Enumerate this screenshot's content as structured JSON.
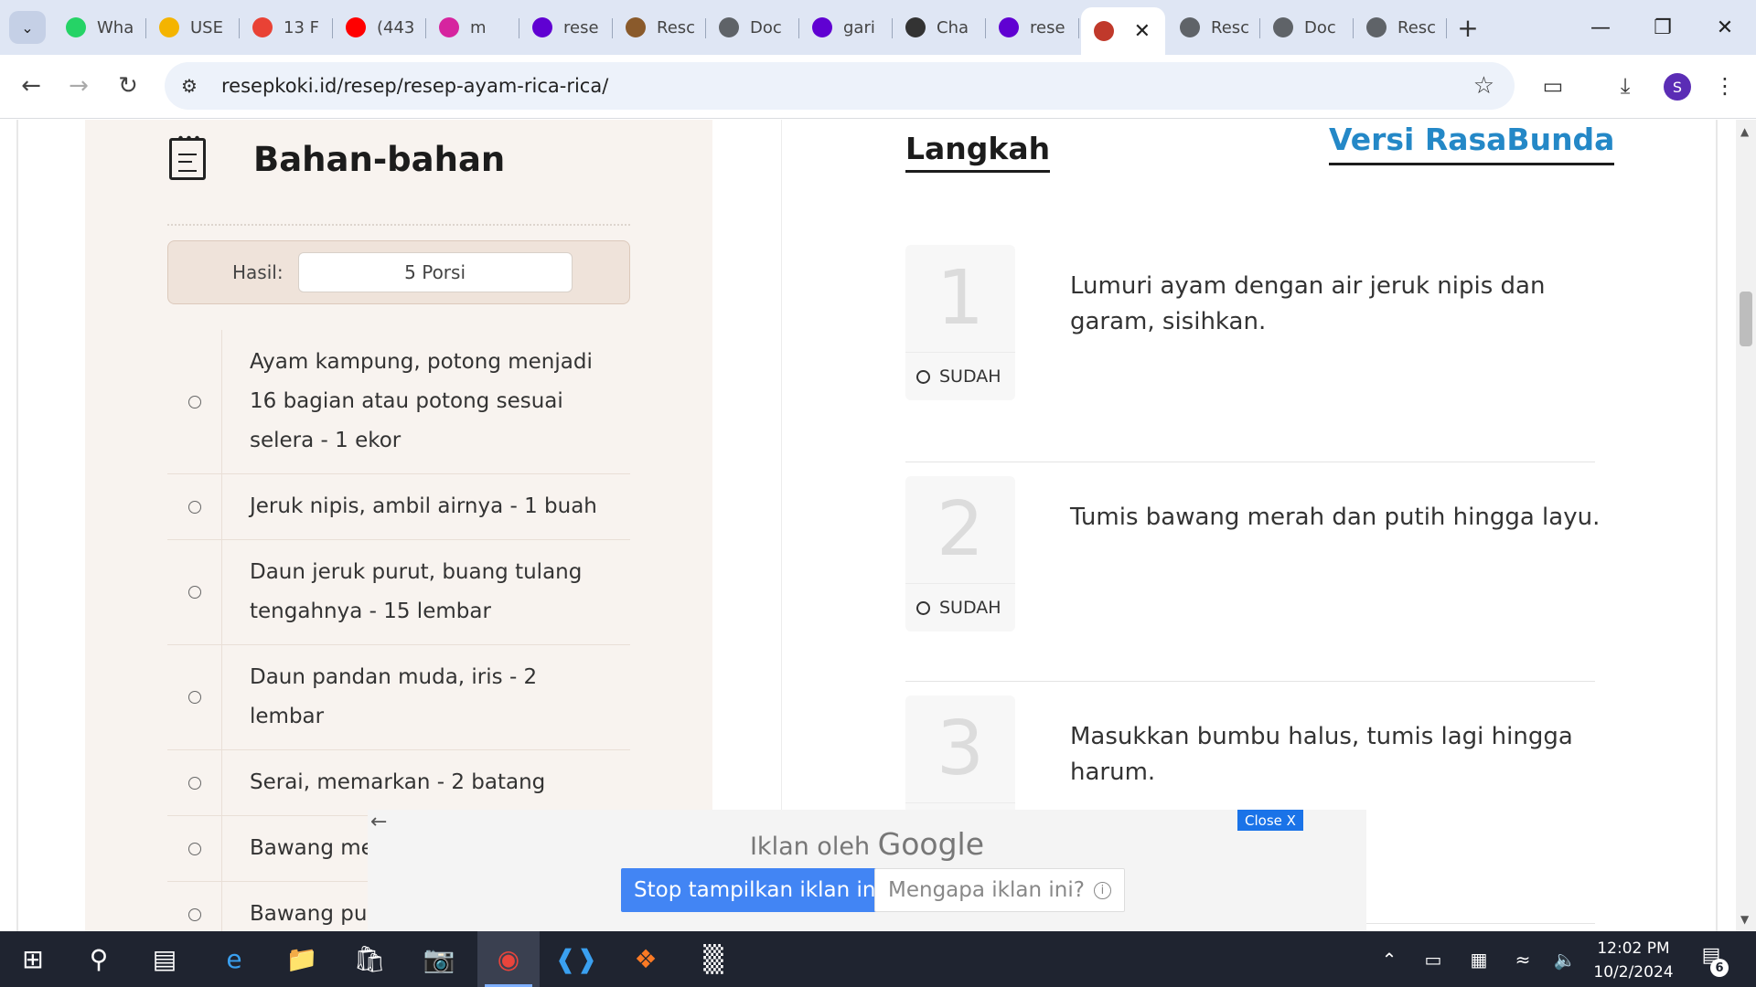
{
  "browser": {
    "tabs": [
      {
        "label": "Wha",
        "icon": "whatsapp-icon",
        "color": "#25d366"
      },
      {
        "label": "USE",
        "icon": "google-drive-icon",
        "color": "#f4b400"
      },
      {
        "label": "13 F",
        "icon": "pinwheel-icon",
        "color": "#e94235"
      },
      {
        "label": "(443",
        "icon": "youtube-icon",
        "color": "#ff0000"
      },
      {
        "label": "m",
        "icon": "instagram-icon",
        "color": "#d6249f"
      },
      {
        "label": "rese",
        "icon": "yahoo-icon",
        "color": "#6001d2"
      },
      {
        "label": "Resc",
        "icon": "cookie-icon",
        "color": "#8a5a2b"
      },
      {
        "label": "Doc",
        "icon": "globe-icon",
        "color": "#5f6368"
      },
      {
        "label": "gari",
        "icon": "yahoo-icon",
        "color": "#6001d2"
      },
      {
        "label": "Cha",
        "icon": "openai-icon",
        "color": "#333333"
      },
      {
        "label": "rese",
        "icon": "yahoo-icon",
        "color": "#6001d2"
      }
    ],
    "active_tab": {
      "label": "",
      "icon": "resepkoki-icon",
      "color": "#c0392b"
    },
    "tabs_after": [
      {
        "label": "Resc",
        "icon": "globe-icon",
        "color": "#5f6368"
      },
      {
        "label": "Doc",
        "icon": "globe-icon",
        "color": "#5f6368"
      },
      {
        "label": "Resc",
        "icon": "globe-icon",
        "color": "#5f6368"
      }
    ],
    "url": "resepkoki.id/resep/resep-ayam-rica-rica/"
  },
  "ingredients": {
    "title": "Bahan-bahan",
    "yield_label": "Hasil:",
    "yield_value": "5 Porsi",
    "items": [
      "Ayam kampung, potong menjadi 16 bagian atau potong sesuai selera - 1 ekor",
      "Jeruk nipis, ambil airnya - 1 buah",
      "Daun jeruk purut, buang tulang tengahnya - 15 lembar",
      "Daun pandan muda, iris - 2 lembar",
      "Serai, memarkan - 2 batang",
      "Bawang me",
      "Bawang put"
    ]
  },
  "steps": {
    "title": "Langkah",
    "alt_version_link": "Versi RasaBunda",
    "done_label": "SUDAH",
    "items": [
      {
        "number": "1",
        "text": "Lumuri ayam dengan air jeruk nipis dan garam, sisihkan."
      },
      {
        "number": "2",
        "text": "Tumis bawang merah dan putih hingga layu."
      },
      {
        "number": "3",
        "text": "Masukkan bumbu halus, tumis lagi hingga harum."
      }
    ]
  },
  "ad": {
    "close_label": "Close X",
    "by_label": "Iklan oleh",
    "brand": "Google",
    "stop_label": "Stop tampilkan iklan ini",
    "why_label": "Mengapa iklan ini?"
  },
  "taskbar": {
    "time": "12:02 PM",
    "date": "10/2/2024",
    "notification_count": "6"
  }
}
